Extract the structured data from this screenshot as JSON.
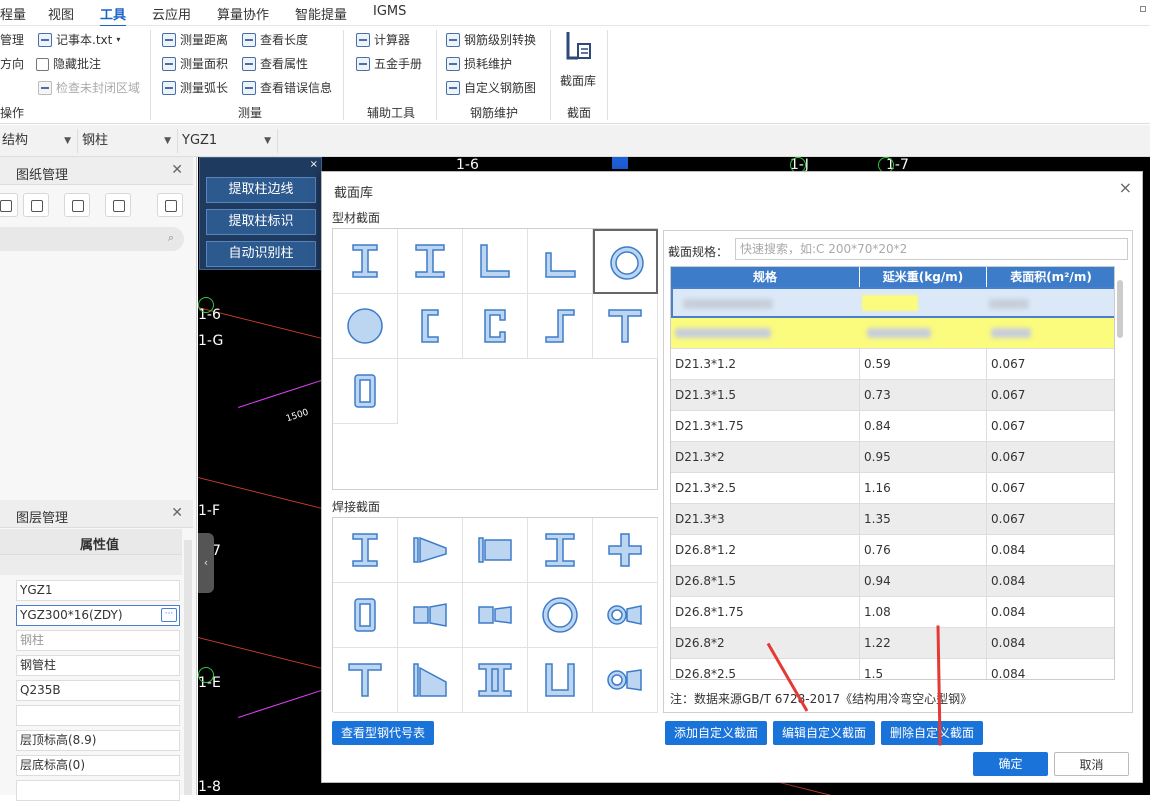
{
  "menu": {
    "items": [
      "程量",
      "视图",
      "工具",
      "云应用",
      "算量协作",
      "智能提量",
      "IGMS"
    ],
    "active_index": 2
  },
  "ribbon": {
    "col1": [
      "管理",
      "方向",
      "操作"
    ],
    "notepad": "记事本.txt",
    "hide_annotation": "隐藏批注",
    "check_unclosed": "检查未封闭区域",
    "measure": {
      "distance": "测量距离",
      "area": "测量面积",
      "arc": "测量弧长",
      "length": "查看长度",
      "attr": "查看属性",
      "error": "查看错误信息",
      "group": "测量"
    },
    "aux": {
      "calculator": "计算器",
      "hardware": "五金手册",
      "group": "辅助工具"
    },
    "rebar": {
      "grade_convert": "钢筋级别转换",
      "loss": "损耗维护",
      "custom_diagram": "自定义钢筋图",
      "group": "钢筋维护"
    },
    "section": {
      "library": "截面库",
      "group": "截面"
    }
  },
  "filter": {
    "a": "结构",
    "b": "钢柱",
    "c": "YGZ1"
  },
  "left": {
    "drawing_panel": "图纸管理",
    "layer_panel": "图层管理",
    "prop_header": "属性值",
    "props": [
      "YGZ1",
      "YGZ300*16(ZDY)",
      "钢柱",
      "钢管柱",
      "Q235B",
      "",
      "层顶标高(8.9)",
      "层底标高(0)"
    ],
    "more": "···"
  },
  "canvas": {
    "labels": [
      "1-6",
      "1-J",
      "1-7",
      "1-6",
      "1-G",
      "1-F",
      "1-E",
      "1-8",
      "7"
    ],
    "dim": "1500"
  },
  "tools": {
    "close": "×",
    "btn1": "提取柱边线",
    "btn2": "提取柱标识",
    "btn3": "自动识别柱"
  },
  "dialog": {
    "title": "截面库",
    "close": "×",
    "profile_section": "型材截面",
    "welded_section": "焊接截面",
    "view_code_btn": "查看型钢代号表",
    "spec_label": "截面规格：",
    "spec_placeholder": "快速搜索，如:C 200*70*20*2",
    "columns": [
      "规格",
      "延米重(kg/m)",
      "表面积(m²/m)"
    ],
    "rows": [
      [
        "D21.3*1.2",
        "0.59",
        "0.067"
      ],
      [
        "D21.3*1.5",
        "0.73",
        "0.067"
      ],
      [
        "D21.3*1.75",
        "0.84",
        "0.067"
      ],
      [
        "D21.3*2",
        "0.95",
        "0.067"
      ],
      [
        "D21.3*2.5",
        "1.16",
        "0.067"
      ],
      [
        "D21.3*3",
        "1.35",
        "0.067"
      ],
      [
        "D26.8*1.2",
        "0.76",
        "0.084"
      ],
      [
        "D26.8*1.5",
        "0.94",
        "0.084"
      ],
      [
        "D26.8*1.75",
        "1.08",
        "0.084"
      ],
      [
        "D26.8*2",
        "1.22",
        "0.084"
      ],
      [
        "D26.8*2.5",
        "1.5",
        "0.084"
      ]
    ],
    "note": "注：数据来源GB/T 6728-2017《结构用冷弯空心型钢》",
    "add_btn": "添加自定义截面",
    "edit_btn": "编辑自定义截面",
    "delete_btn": "删除自定义截面",
    "ok_btn": "确定",
    "cancel_btn": "取消"
  },
  "colors": {
    "accent": "#1a73d9",
    "header": "#3d7cc9",
    "highlight": "#fbfb7e",
    "arrow": "#e53935"
  }
}
